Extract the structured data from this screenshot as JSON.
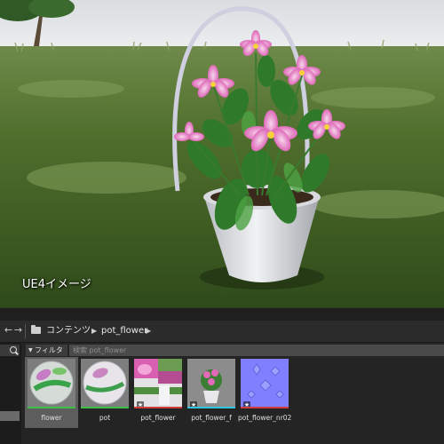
{
  "viewport": {
    "caption": "UE4イメージ"
  },
  "content_browser": {
    "nav": {
      "back_icon": "arrow-left-icon",
      "forward_icon": "arrow-right-icon",
      "folder_icon": "folder-icon",
      "breadcrumbs": [
        "コンテンツ",
        "pot_flower"
      ]
    },
    "filter": {
      "label": "フィルタ",
      "search_placeholder": "検索 pot_flower"
    },
    "assets": [
      {
        "name": "flower",
        "kind": "material",
        "type_color": "#3fbf4a",
        "selected": true
      },
      {
        "name": "pot",
        "kind": "material",
        "type_color": "#3fbf4a",
        "selected": false
      },
      {
        "name": "pot_flower",
        "kind": "texture",
        "type_color": "#d03b3b",
        "selected": false
      },
      {
        "name": "pot_flower_f",
        "kind": "static-mesh",
        "type_color": "#31c6dd",
        "selected": false
      },
      {
        "name": "pot_flower_nr02",
        "kind": "texture",
        "type_color": "#d03b3b",
        "selected": false
      }
    ]
  }
}
